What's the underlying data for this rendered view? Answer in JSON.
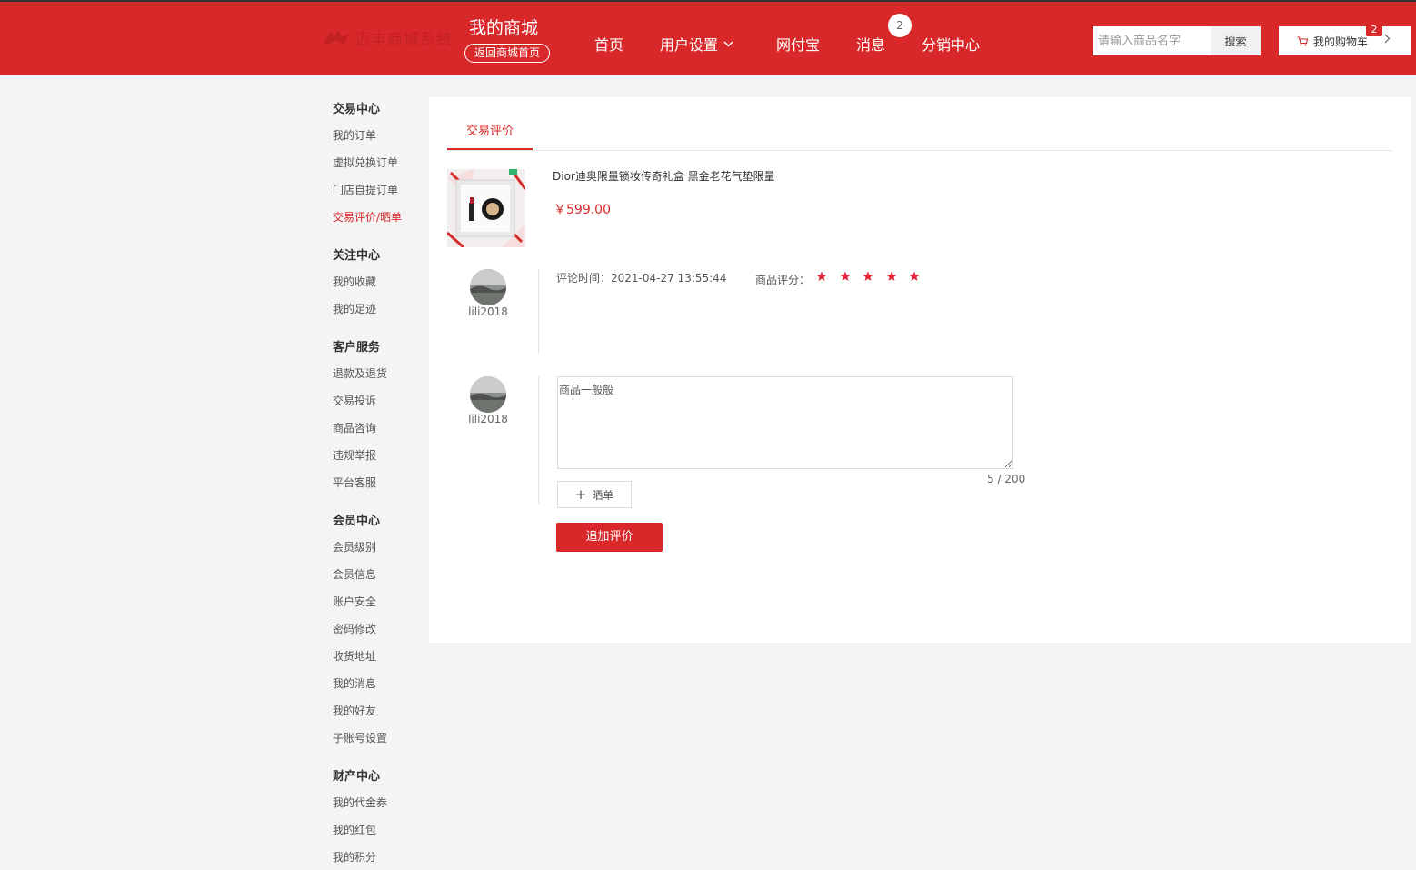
{
  "header": {
    "logo_text": "迈丰商城系统",
    "mall_title": "我的商城",
    "back_home_label": "返回商城首页",
    "nav": {
      "home": "首页",
      "user_settings": "用户设置",
      "wangfubao": "网付宝",
      "messages": "消息",
      "distribution": "分销中心"
    },
    "message_count": "2",
    "search_placeholder": "请输入商品名字",
    "search_button": "搜索",
    "cart_label": "我的购物车",
    "cart_count": "2",
    "brand_color": "#d9282a"
  },
  "sidebar": {
    "sections": [
      {
        "title": "交易中心",
        "items": [
          "我的订单",
          "虚拟兑换订单",
          "门店自提订单",
          "交易评价/晒单"
        ]
      },
      {
        "title": "关注中心",
        "items": [
          "我的收藏",
          "我的足迹"
        ]
      },
      {
        "title": "客户服务",
        "items": [
          "退款及退货",
          "交易投诉",
          "商品咨询",
          "违规举报",
          "平台客服"
        ]
      },
      {
        "title": "会员中心",
        "items": [
          "会员级别",
          "会员信息",
          "账户安全",
          "密码修改",
          "收货地址",
          "我的消息",
          "我的好友",
          "子账号设置"
        ]
      },
      {
        "title": "财产中心",
        "items": [
          "我的代金券",
          "我的红包",
          "我的积分"
        ]
      }
    ],
    "active_item": "交易评价/晒单"
  },
  "main": {
    "tab_label": "交易评价",
    "product": {
      "name": "Dior迪奥限量锁妆传奇礼盒 黑金老花气垫限量",
      "price": "￥599.00"
    },
    "review": {
      "username": "lili2018",
      "time_label": "评论时间：2021-04-27 13:55:44",
      "rating_label": "商品评分：",
      "stars": 5,
      "star_color": "#e4263a"
    },
    "followup": {
      "username": "lili2018",
      "text": "商品一般般",
      "counter": "5 / 200",
      "upload_label": "晒单",
      "submit_label": "追加评价"
    }
  }
}
